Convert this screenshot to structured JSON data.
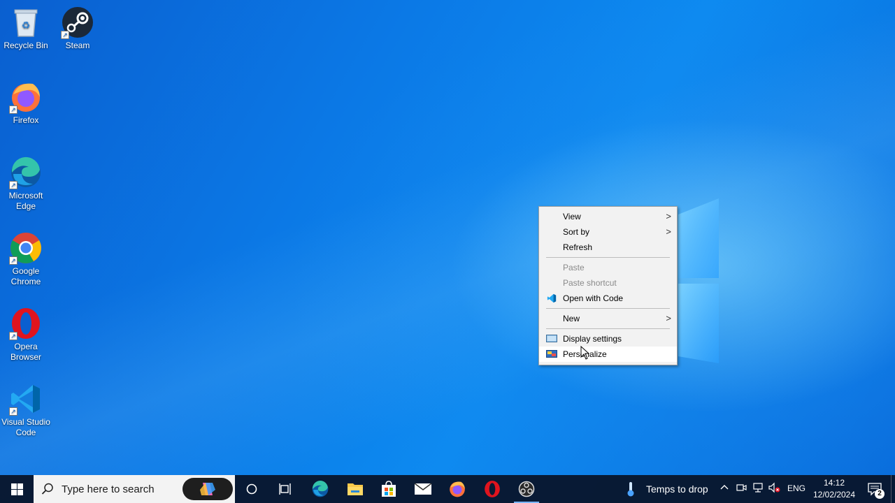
{
  "desktop": {
    "icons": [
      {
        "label": "Recycle Bin",
        "icon": "recycle-bin-icon"
      },
      {
        "label": "Steam",
        "icon": "steam-icon"
      },
      {
        "label": "Firefox",
        "icon": "firefox-icon"
      },
      {
        "label": "Microsoft Edge",
        "icon": "edge-icon"
      },
      {
        "label": "Google Chrome",
        "icon": "chrome-icon"
      },
      {
        "label": "Opera Browser",
        "icon": "opera-icon"
      },
      {
        "label": "Visual Studio Code",
        "icon": "vscode-icon"
      }
    ]
  },
  "context_menu": {
    "items": [
      {
        "label": "View",
        "has_submenu": true
      },
      {
        "label": "Sort by",
        "has_submenu": true
      },
      {
        "label": "Refresh"
      },
      {
        "label": "Paste",
        "disabled": true
      },
      {
        "label": "Paste shortcut",
        "disabled": true
      },
      {
        "label": "Open with Code",
        "icon": "vscode-icon"
      },
      {
        "label": "New",
        "has_submenu": true
      },
      {
        "label": "Display settings",
        "icon": "display-icon"
      },
      {
        "label": "Personalize",
        "icon": "personalize-icon",
        "hovered": true
      }
    ],
    "submenu_arrow": ">"
  },
  "taskbar": {
    "search_placeholder": "Type here to search",
    "weather_text": "Temps to drop",
    "language": "ENG",
    "time": "14:12",
    "date": "12/02/2024",
    "notification_count": "2",
    "pinned": [
      "cortana-icon",
      "task-view-icon",
      "edge-icon",
      "file-explorer-icon",
      "store-icon",
      "mail-icon",
      "firefox-icon",
      "opera-icon",
      "obs-icon"
    ]
  },
  "colors": {
    "accent": "#0078d7",
    "taskbar": "#08162d",
    "menu_bg": "#f2f2f2"
  }
}
